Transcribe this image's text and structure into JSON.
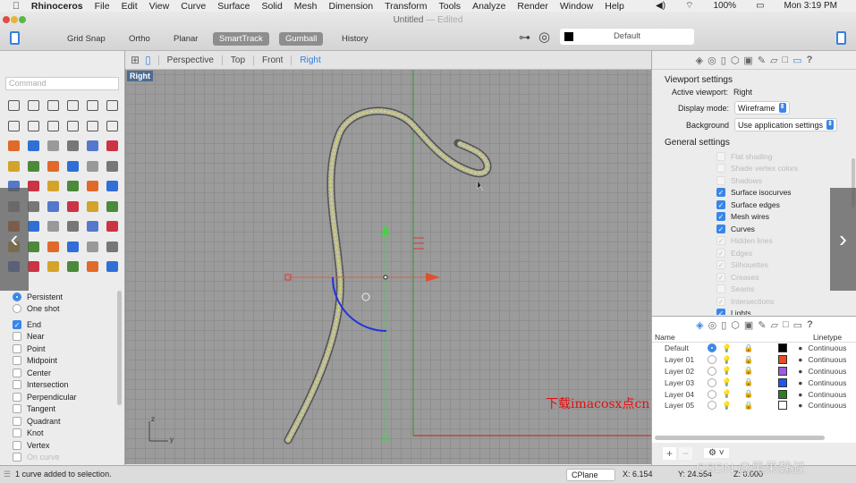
{
  "menubar": {
    "app": "Rhinoceros",
    "items": [
      "File",
      "Edit",
      "View",
      "Curve",
      "Surface",
      "Solid",
      "Mesh",
      "Dimension",
      "Transform",
      "Tools",
      "Analyze",
      "Render",
      "Window",
      "Help"
    ],
    "battery": "100%",
    "clock": "Mon 3:19 PM"
  },
  "window": {
    "title": "Untitled",
    "edited": "— Edited"
  },
  "toolbar": {
    "grid_snap": "Grid Snap",
    "ortho": "Ortho",
    "planar": "Planar",
    "smarttrack": "SmartTrack",
    "gumball": "Gumball",
    "history": "History",
    "layer": "Default"
  },
  "viewport_tabs": [
    "Perspective",
    "Top",
    "Front",
    "Right"
  ],
  "viewport": {
    "label": "Right",
    "axis_z": "z",
    "axis_y": "y"
  },
  "command": {
    "placeholder": "Command"
  },
  "osnap": {
    "modes": [
      {
        "label": "Persistent",
        "on": true
      },
      {
        "label": "One shot",
        "on": false
      }
    ],
    "items": [
      {
        "label": "End",
        "on": true
      },
      {
        "label": "Near"
      },
      {
        "label": "Point"
      },
      {
        "label": "Midpoint"
      },
      {
        "label": "Center"
      },
      {
        "label": "Intersection"
      },
      {
        "label": "Perpendicular"
      },
      {
        "label": "Tangent"
      },
      {
        "label": "Quadrant"
      },
      {
        "label": "Knot"
      },
      {
        "label": "Vertex"
      },
      {
        "label": "On curve",
        "dim": true
      }
    ]
  },
  "viewport_settings": {
    "title": "Viewport settings",
    "active_label": "Active viewport:",
    "active_value": "Right",
    "display_label": "Display mode:",
    "display_value": "Wireframe",
    "background_label": "Background",
    "background_value": "Use application settings"
  },
  "general_settings": {
    "title": "General settings",
    "items": [
      {
        "label": "Flat shading",
        "state": "off-dim"
      },
      {
        "label": "Shade vertex colors",
        "state": "off-dim"
      },
      {
        "label": "Shadows",
        "state": "off-dim"
      },
      {
        "label": "Surface isocurves",
        "state": "on"
      },
      {
        "label": "Surface edges",
        "state": "on"
      },
      {
        "label": "Mesh wires",
        "state": "on"
      },
      {
        "label": "Curves",
        "state": "on"
      },
      {
        "label": "Hidden lines",
        "state": "on-dim"
      },
      {
        "label": "Edges",
        "state": "on-dim"
      },
      {
        "label": "Silhouettes",
        "state": "on-dim"
      },
      {
        "label": "Creases",
        "state": "on-dim"
      },
      {
        "label": "Seams",
        "state": "off-dim"
      },
      {
        "label": "Intersections",
        "state": "on-dim"
      },
      {
        "label": "Lights",
        "state": "on"
      }
    ]
  },
  "layers": {
    "col_name": "Name",
    "col_linetype": "Linetype",
    "rows": [
      {
        "name": "Default",
        "color": "#000000",
        "linetype": "Continuous",
        "current": true
      },
      {
        "name": "Layer 01",
        "color": "#e84c23",
        "linetype": "Continuous"
      },
      {
        "name": "Layer 02",
        "color": "#9b5de0",
        "linetype": "Continuous"
      },
      {
        "name": "Layer 03",
        "color": "#1f55f0",
        "linetype": "Continuous"
      },
      {
        "name": "Layer 04",
        "color": "#2e7d22",
        "linetype": "Continuous"
      },
      {
        "name": "Layer 05",
        "color": "#ffffff",
        "linetype": "Continuous"
      }
    ]
  },
  "status": {
    "message": "1 curve added to selection.",
    "cplane": "CPlane",
    "x": "X: 6.154",
    "y": "Y: 24.554",
    "z": "Z: 0.000"
  },
  "watermarks": {
    "site": "下载imacosx点cn",
    "csdn": "CSDN @黑果魏叔"
  }
}
